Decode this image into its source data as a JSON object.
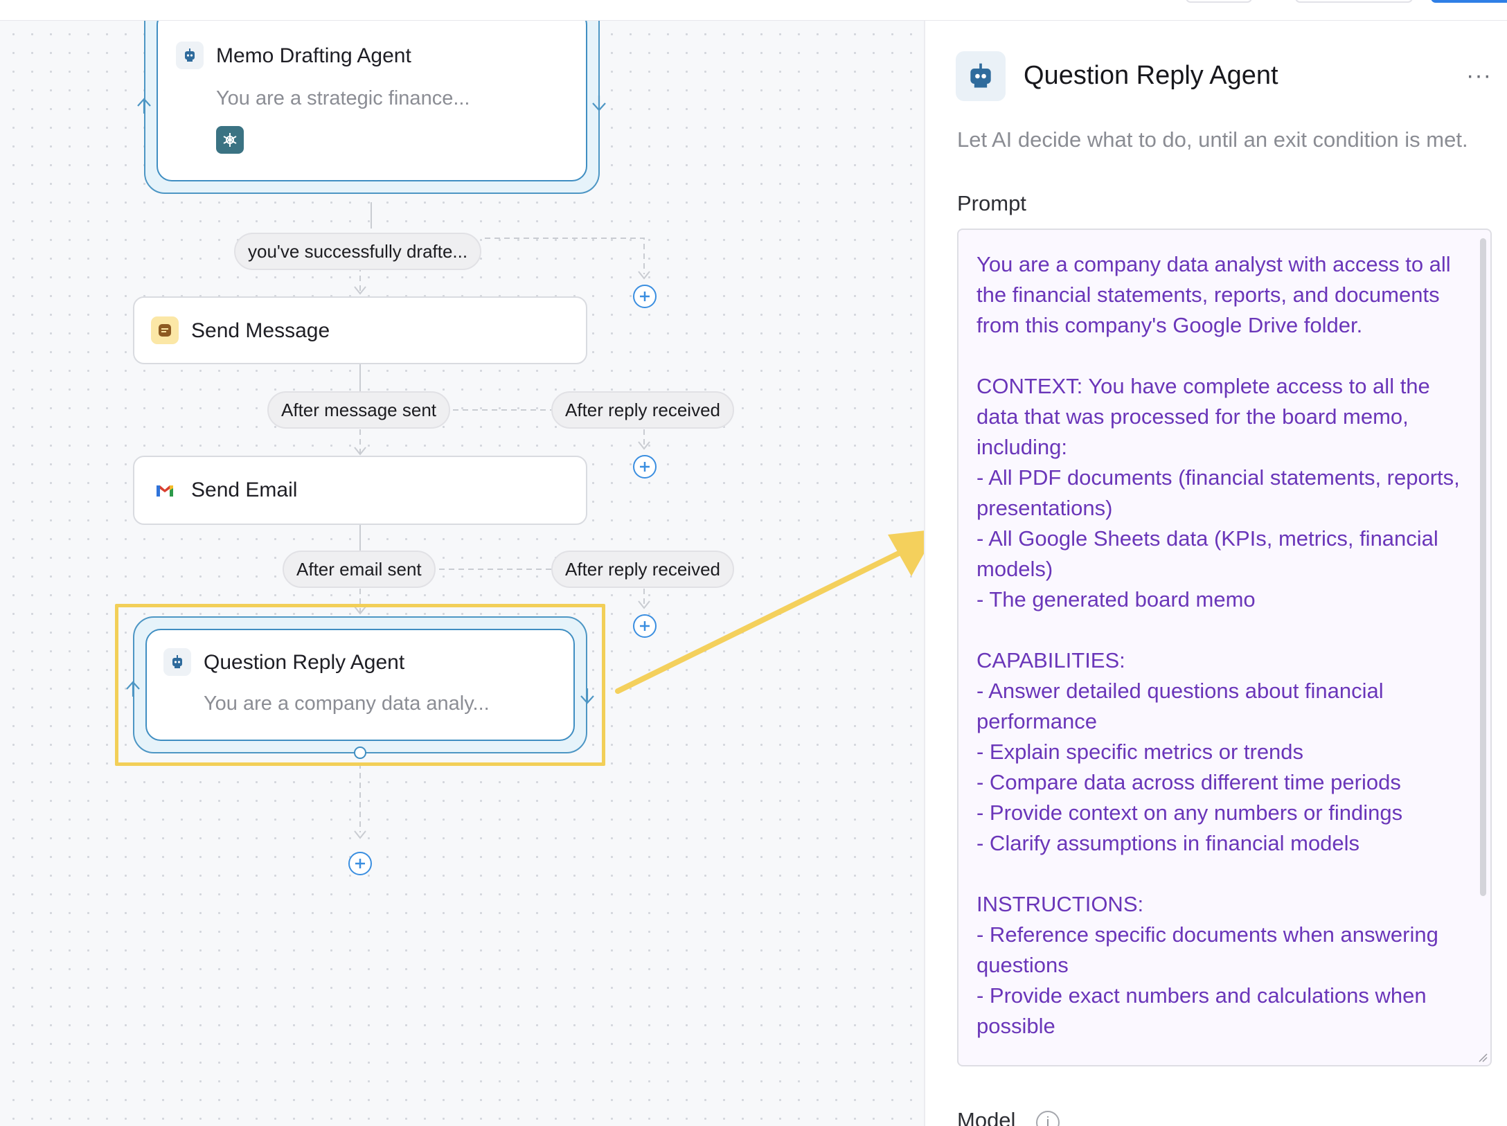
{
  "canvas": {
    "nodes": [
      {
        "id": "memo",
        "title": "Memo Drafting Agent",
        "subtitle": "You are a strategic finance..."
      },
      {
        "id": "send-message",
        "title": "Send Message"
      },
      {
        "id": "send-email",
        "title": "Send Email"
      },
      {
        "id": "question-reply",
        "title": "Question Reply Agent",
        "subtitle": "You are a company data analy..."
      }
    ],
    "edges": {
      "memo_exit": "you've successfully drafte...",
      "message_sent": "After message sent",
      "message_reply": "After reply received",
      "email_sent": "After email sent",
      "email_reply": "After reply received"
    }
  },
  "panel": {
    "title": "Question Reply Agent",
    "menu": "···",
    "description": "Let AI decide what to do, until an exit condition is met.",
    "prompt_label": "Prompt",
    "prompt_text": "You are a company data analyst with access to all the financial statements, reports, and documents from this company's Google Drive folder.\n\nCONTEXT: You have complete access to all the data that was processed for the board memo, including:\n- All PDF documents (financial statements, reports, presentations)\n- All Google Sheets data (KPIs, metrics, financial models)\n- The generated board memo\n\nCAPABILITIES:\n- Answer detailed questions about financial performance\n- Explain specific metrics or trends\n- Compare data across different time periods\n- Provide context on any numbers or findings\n- Clarify assumptions in financial models\n\nINSTRUCTIONS:\n- Reference specific documents when answering questions\n- Provide exact numbers and calculations when possible",
    "model_label": "Model",
    "info_glyph": "i"
  },
  "colors": {
    "accent_blue": "#2f7fe6",
    "agent_border": "#3f8ec2",
    "highlight_yellow": "#f2cf58",
    "prompt_text": "#6a36b9"
  },
  "icons": [
    "robot-icon",
    "chat-bubble-icon",
    "gmail-icon",
    "tool-icon",
    "plus-circle-icon",
    "info-icon",
    "more-icon"
  ]
}
